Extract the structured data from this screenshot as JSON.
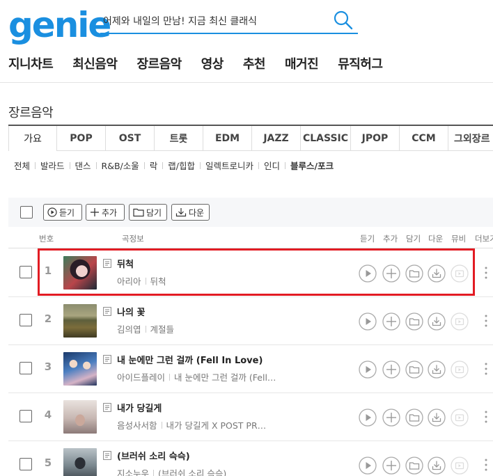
{
  "header": {
    "logo": "genie",
    "search_value": "어제와 내일의 만남! 지금 최신 클래식"
  },
  "gnb": [
    "지니차트",
    "최신음악",
    "장르음악",
    "영상",
    "추천",
    "매거진",
    "뮤직허그"
  ],
  "page_title": "장르음악",
  "tabs": [
    {
      "label": "가요",
      "active": true
    },
    {
      "label": "POP"
    },
    {
      "label": "OST"
    },
    {
      "label": "트롯"
    },
    {
      "label": "EDM"
    },
    {
      "label": "JAZZ"
    },
    {
      "label": "CLASSIC"
    },
    {
      "label": "JPOP"
    },
    {
      "label": "CCM"
    },
    {
      "label": "그외장르"
    }
  ],
  "subgenres": [
    {
      "label": "전체"
    },
    {
      "label": "발라드"
    },
    {
      "label": "댄스"
    },
    {
      "label": "R&B/소울"
    },
    {
      "label": "락"
    },
    {
      "label": "랩/힙합"
    },
    {
      "label": "일렉트로니카"
    },
    {
      "label": "인디"
    },
    {
      "label": "블루스/포크",
      "selected": true
    }
  ],
  "toolbar": {
    "listen": "듣기",
    "add": "추가",
    "save": "담기",
    "download": "다운"
  },
  "columns": {
    "number": "번호",
    "info": "곡정보",
    "listen": "듣기",
    "add": "추가",
    "save": "담기",
    "download": "다운",
    "mv": "뮤비",
    "more": "더보기"
  },
  "songs": [
    {
      "rank": "1",
      "title": "뒤척",
      "artist": "아리아",
      "album": "뒤척"
    },
    {
      "rank": "2",
      "title": "나의 꽃",
      "artist": "김의엽",
      "album": "계절들"
    },
    {
      "rank": "3",
      "title": "내 눈에만 그런 걸까 (Fell In Love)",
      "artist": "아이드플레이",
      "album": "내 눈에만 그런 걸까 (Fell…"
    },
    {
      "rank": "4",
      "title": "내가 당길게",
      "artist": "음성사서함",
      "album": "내가 당길게 X POST PR…"
    },
    {
      "rank": "5",
      "title": "(브러쉬 소리 슥슥)",
      "artist": "지소누우",
      "album": "(브러쉬 소리 슥슥)"
    }
  ],
  "colors": {
    "brand": "#1a8fe0",
    "highlight": "#e21b23"
  }
}
